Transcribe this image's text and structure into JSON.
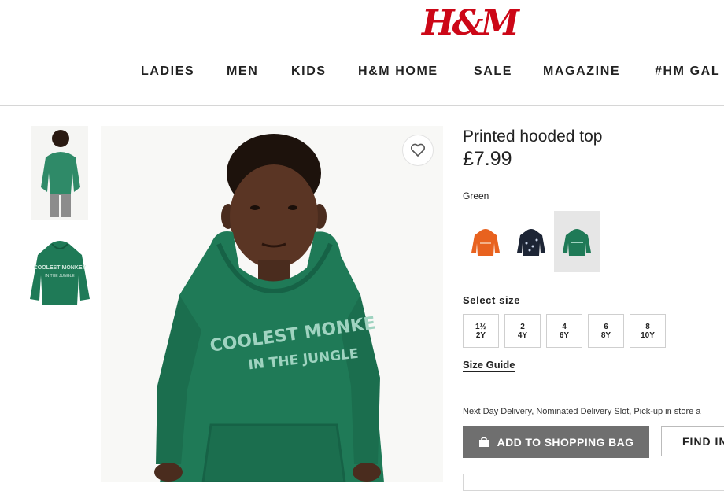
{
  "header": {
    "logo": "H&M",
    "nav": [
      "LADIES",
      "MEN",
      "KIDS",
      "H&M HOME",
      "SALE",
      "MAGAZINE",
      "#HM GAL"
    ]
  },
  "gallery": {
    "hoodie_print_line1": "COOLEST MONKE",
    "hoodie_print_line2": "IN THE JUNGLE",
    "thumb_print_line1": "COOLEST MONKEY",
    "thumb_print_line2": "IN THE JUNGLE"
  },
  "product": {
    "title": "Printed hooded top",
    "price": "£7.99",
    "color_label": "Green",
    "swatches": [
      {
        "name": "orange",
        "color": "#e8621f"
      },
      {
        "name": "navy",
        "color": "#1d2535"
      },
      {
        "name": "green",
        "color": "#1f7a57"
      }
    ],
    "size_label": "Select size",
    "sizes": [
      {
        "top": "1½",
        "bottom": "2Y"
      },
      {
        "top": "2",
        "bottom": "4Y"
      },
      {
        "top": "4",
        "bottom": "6Y"
      },
      {
        "top": "6",
        "bottom": "8Y"
      },
      {
        "top": "8",
        "bottom": "10Y"
      }
    ],
    "size_guide": "Size Guide",
    "delivery": "Next Day Delivery, Nominated Delivery Slot, Pick-up in store a",
    "add_to_bag": "ADD TO SHOPPING BAG",
    "find_in_store": "FIND IN"
  },
  "colors": {
    "brand_red": "#cc0717",
    "hoodie_green": "#1f7a57",
    "button_gray": "#6f6f6f"
  },
  "icons": [
    "heart-icon",
    "shopping-bag-icon"
  ]
}
